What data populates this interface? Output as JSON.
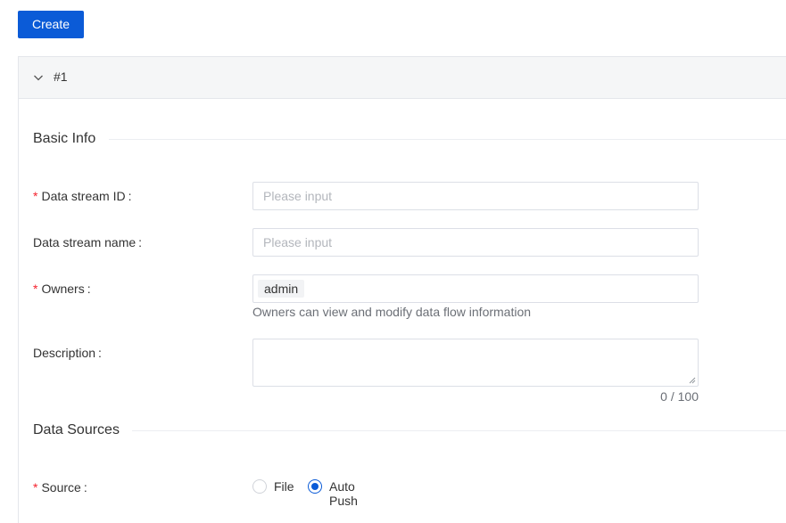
{
  "toolbar": {
    "create_label": "Create"
  },
  "panel": {
    "title": "#1"
  },
  "sections": {
    "basic_info": "Basic Info",
    "data_sources": "Data Sources"
  },
  "fields": {
    "stream_id": {
      "label": "Data stream ID",
      "required": true,
      "placeholder": "Please input",
      "value": ""
    },
    "stream_name": {
      "label": "Data stream name",
      "required": false,
      "placeholder": "Please input",
      "value": ""
    },
    "owners": {
      "label": "Owners",
      "required": true,
      "tags": [
        "admin"
      ],
      "help": "Owners can view and modify data flow information"
    },
    "description": {
      "label": "Description",
      "required": false,
      "value": "",
      "counter": "0 / 100"
    },
    "source": {
      "label": "Source",
      "required": true,
      "options": [
        "File",
        "Auto Push"
      ],
      "selected": "Auto Push"
    }
  },
  "common": {
    "colon": ":",
    "required_mark": "*"
  },
  "colors": {
    "primary": "#0b5bd7",
    "required": "#f5222d"
  },
  "icons": {
    "collapse": "chevron-down-icon",
    "resize": "resize-grip-icon"
  }
}
